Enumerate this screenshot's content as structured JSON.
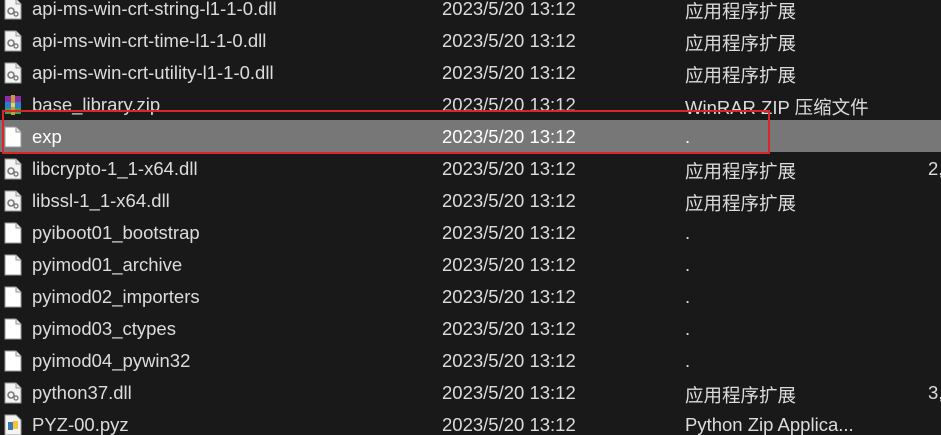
{
  "files": [
    {
      "name": "api-ms-win-crt-string-l1-1-0.dll",
      "date": "2023/5/20 13:12",
      "type": "应用程序扩展",
      "size": "",
      "icon": "dll-file-icon"
    },
    {
      "name": "api-ms-win-crt-time-l1-1-0.dll",
      "date": "2023/5/20 13:12",
      "type": "应用程序扩展",
      "size": "",
      "icon": "dll-file-icon"
    },
    {
      "name": "api-ms-win-crt-utility-l1-1-0.dll",
      "date": "2023/5/20 13:12",
      "type": "应用程序扩展",
      "size": "",
      "icon": "dll-file-icon"
    },
    {
      "name": "base_library.zip",
      "date": "2023/5/20 13:12",
      "type": "WinRAR ZIP 压缩文件",
      "size": "",
      "icon": "winrar-archive-icon"
    },
    {
      "name": "exp",
      "date": "2023/5/20 13:12",
      "type": ".",
      "size": "",
      "icon": "blank-file-icon",
      "selected": true
    },
    {
      "name": "libcrypto-1_1-x64.dll",
      "date": "2023/5/20 13:12",
      "type": "应用程序扩展",
      "size": "2,",
      "icon": "dll-file-icon"
    },
    {
      "name": "libssl-1_1-x64.dll",
      "date": "2023/5/20 13:12",
      "type": "应用程序扩展",
      "size": "",
      "icon": "dll-file-icon"
    },
    {
      "name": "pyiboot01_bootstrap",
      "date": "2023/5/20 13:12",
      "type": ".",
      "size": "",
      "icon": "blank-file-icon"
    },
    {
      "name": "pyimod01_archive",
      "date": "2023/5/20 13:12",
      "type": ".",
      "size": "",
      "icon": "blank-file-icon"
    },
    {
      "name": "pyimod02_importers",
      "date": "2023/5/20 13:12",
      "type": ".",
      "size": "",
      "icon": "blank-file-icon"
    },
    {
      "name": "pyimod03_ctypes",
      "date": "2023/5/20 13:12",
      "type": ".",
      "size": "",
      "icon": "blank-file-icon"
    },
    {
      "name": "pyimod04_pywin32",
      "date": "2023/5/20 13:12",
      "type": ".",
      "size": "",
      "icon": "blank-file-icon"
    },
    {
      "name": "python37.dll",
      "date": "2023/5/20 13:12",
      "type": "应用程序扩展",
      "size": "3,",
      "icon": "dll-file-icon"
    },
    {
      "name": "PYZ-00.pyz",
      "date": "2023/5/20 13:12",
      "type": "Python Zip Applica...",
      "size": "",
      "icon": "python-file-icon"
    }
  ],
  "colors": {
    "background": "#191919",
    "selected_row": "#777777",
    "highlight_border": "#d9262d",
    "text": "#dcdcdc"
  }
}
